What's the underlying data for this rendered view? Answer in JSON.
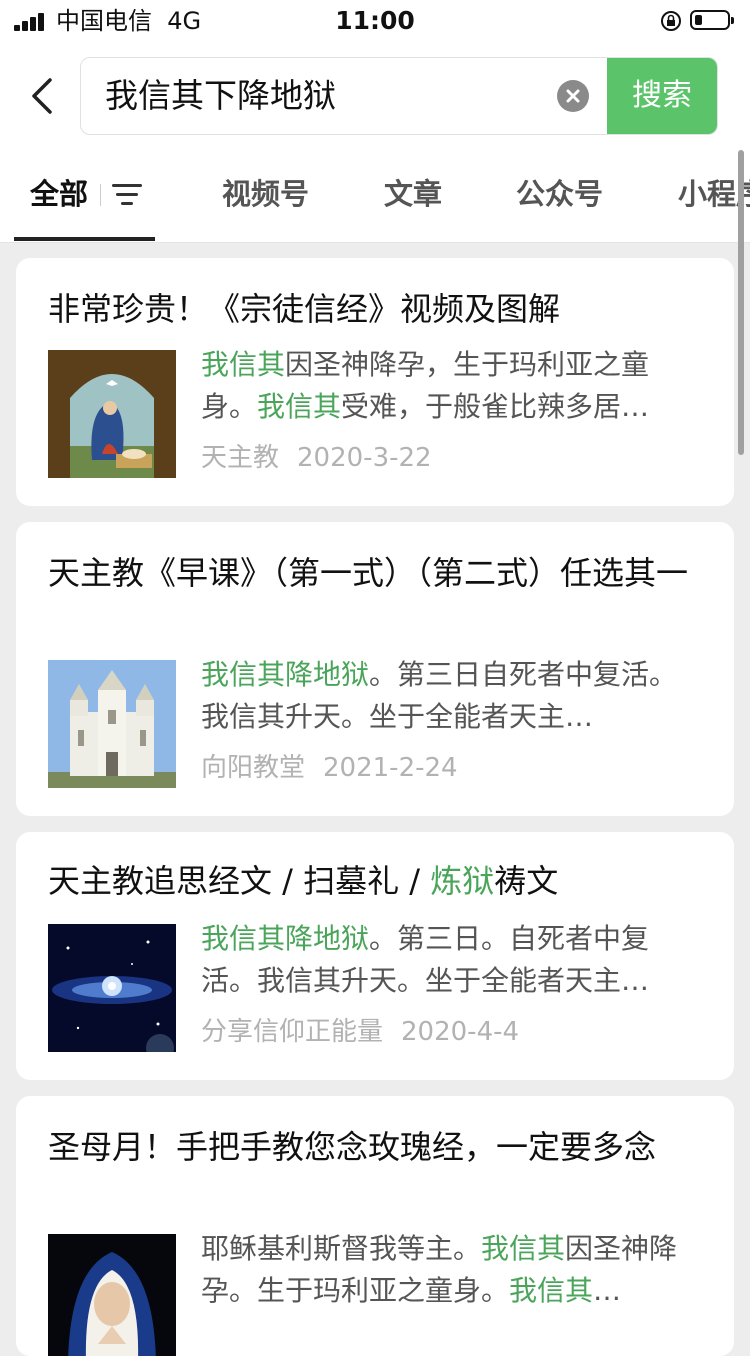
{
  "status_bar": {
    "carrier": "中国电信",
    "network": "4G",
    "time": "11:00"
  },
  "search": {
    "query": "我信其下降地狱",
    "button_label": "搜索"
  },
  "tabs": [
    {
      "label": "全部",
      "active": true
    },
    {
      "label": "视频号"
    },
    {
      "label": "文章"
    },
    {
      "label": "公众号"
    },
    {
      "label": "小程序"
    }
  ],
  "results": [
    {
      "title": "非常珍贵！《宗徒信经》视频及图解",
      "snippet_parts": [
        {
          "text": "我信其",
          "hl": true
        },
        {
          "text": "因圣神降孕，生于玛利亚之童"
        },
        {
          "text": "身。"
        },
        {
          "text": "我信其",
          "hl": true
        },
        {
          "text": "受难，于般雀比辣多居…"
        }
      ],
      "source": "天主教",
      "date": "2020-3-22",
      "thumb": "nativity-painting"
    },
    {
      "title": "天主教《早课》（第一式）（第二式）任选其一",
      "snippet_parts": [
        {
          "text": "我信其降地狱",
          "hl": true
        },
        {
          "text": "。第三日自死者中复活。我信其升天。坐于全能者天主…"
        }
      ],
      "source": "向阳教堂",
      "date": "2021-2-24",
      "thumb": "church-building"
    },
    {
      "title_parts": [
        {
          "text": "天主教追思经文 / 扫墓礼 / "
        },
        {
          "text": "炼狱",
          "hl": true
        },
        {
          "text": "祷文"
        }
      ],
      "snippet_parts": [
        {
          "text": "我信其降地狱",
          "hl": true
        },
        {
          "text": "。第三日。自死者中复活。我信其升天。坐于全能者天主…"
        }
      ],
      "source": "分享信仰正能量",
      "date": "2020-4-4",
      "thumb": "galaxy-image"
    },
    {
      "title": "圣母月！手把手教您念玫瑰经，一定要多念",
      "snippet_parts": [
        {
          "text": "耶稣基利斯督我等主。"
        },
        {
          "text": "我信其",
          "hl": true
        },
        {
          "text": "因圣神降孕。生于玛利亚之童身。"
        },
        {
          "text": "我信其",
          "hl": true
        },
        {
          "text": "…"
        }
      ],
      "thumb": "madonna-painting"
    }
  ]
}
